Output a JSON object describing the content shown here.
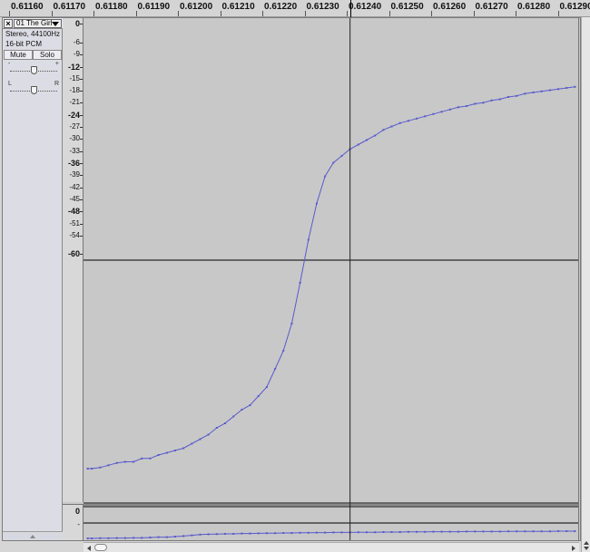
{
  "ruler": {
    "labels": [
      "0.61160",
      "0.61170",
      "0.61180",
      "0.61190",
      "0.61200",
      "0.61210",
      "0.61220",
      "0.61230",
      "0.61240",
      "0.61250",
      "0.61260",
      "0.61270",
      "0.61280",
      "0.61290"
    ]
  },
  "track": {
    "close_label": "×",
    "name": "01 The Girl",
    "info_line1": "Stereo, 44100Hz",
    "info_line2": "16-bit PCM",
    "mute_label": "Mute",
    "solo_label": "Solo",
    "gain_min_label": "-",
    "gain_max_label": "+",
    "pan_left_label": "L",
    "pan_right_label": "R",
    "gain_level": 0.5,
    "pan_level": 0.5
  },
  "scale_top": {
    "labels": [
      {
        "text": "0",
        "bold": true
      },
      {
        "text": "-6",
        "bold": false
      },
      {
        "text": "-9",
        "bold": false
      },
      {
        "text": "-12",
        "bold": true
      },
      {
        "text": "-15",
        "bold": false
      },
      {
        "text": "-18",
        "bold": false
      },
      {
        "text": "-21",
        "bold": false
      },
      {
        "text": "-24",
        "bold": true
      },
      {
        "text": "-27",
        "bold": false
      },
      {
        "text": "-30",
        "bold": false
      },
      {
        "text": "-33",
        "bold": false
      },
      {
        "text": "-36",
        "bold": true
      },
      {
        "text": "-39",
        "bold": false
      },
      {
        "text": "-42",
        "bold": false
      },
      {
        "text": "-45",
        "bold": false
      },
      {
        "text": "-48",
        "bold": true
      },
      {
        "text": "-51",
        "bold": false
      },
      {
        "text": "-54",
        "bold": false
      },
      {
        "text": "-60",
        "bold": true
      }
    ]
  },
  "scale_bottom": {
    "labels": [
      {
        "text": "0",
        "bold": true
      },
      {
        "text": "-",
        "bold": false
      }
    ]
  },
  "colors": {
    "waveform": "#5a5acc",
    "background": "#c8c8c8",
    "cursor": "#222222"
  },
  "chart_data": {
    "type": "line",
    "x": [
      0.61175,
      0.61176,
      0.61178,
      0.6118,
      0.61182,
      0.61184,
      0.61186,
      0.61188,
      0.6119,
      0.61192,
      0.61194,
      0.61196,
      0.61198,
      0.612,
      0.61202,
      0.61204,
      0.61206,
      0.61208,
      0.6121,
      0.61212,
      0.61214,
      0.61216,
      0.61218,
      0.6122,
      0.61222,
      0.61224,
      0.61226,
      0.61228,
      0.6123,
      0.61232,
      0.61234,
      0.61236,
      0.61238,
      0.6124,
      0.61242,
      0.61244,
      0.61246,
      0.61248,
      0.6125,
      0.61252,
      0.61254,
      0.61256,
      0.61258,
      0.6126,
      0.61262,
      0.61264,
      0.61266,
      0.61268,
      0.6127,
      0.61272,
      0.61274,
      0.61276,
      0.61278,
      0.6128,
      0.61282,
      0.61284,
      0.61286,
      0.61288,
      0.6129,
      0.61292
    ],
    "y": [
      -0.92,
      -0.92,
      -0.915,
      -0.905,
      -0.895,
      -0.89,
      -0.89,
      -0.875,
      -0.875,
      -0.86,
      -0.85,
      -0.84,
      -0.83,
      -0.81,
      -0.79,
      -0.77,
      -0.74,
      -0.72,
      -0.69,
      -0.66,
      -0.64,
      -0.6,
      -0.56,
      -0.48,
      -0.4,
      -0.28,
      -0.1,
      0.09,
      0.25,
      0.37,
      0.43,
      0.46,
      0.49,
      0.51,
      0.53,
      0.55,
      0.575,
      0.59,
      0.605,
      0.615,
      0.625,
      0.635,
      0.645,
      0.655,
      0.665,
      0.675,
      0.68,
      0.69,
      0.695,
      0.705,
      0.71,
      0.72,
      0.725,
      0.735,
      0.74,
      0.745,
      0.75,
      0.755,
      0.76,
      0.765
    ],
    "xlim": [
      0.61174,
      0.61293
    ],
    "ylim": [
      -1,
      1
    ],
    "cursor_x": 0.61238
  },
  "chart_data_bottom": {
    "type": "line",
    "y": [
      -0.85,
      -0.85,
      -0.84,
      -0.84,
      -0.83,
      -0.83,
      -0.82,
      -0.82,
      -0.8,
      -0.78,
      -0.78,
      -0.75,
      -0.72,
      -0.68,
      -0.64,
      -0.62,
      -0.61,
      -0.6,
      -0.6,
      -0.58,
      -0.58,
      -0.57,
      -0.56,
      -0.56,
      -0.55,
      -0.55,
      -0.54,
      -0.54,
      -0.53,
      -0.53,
      -0.52,
      -0.52,
      -0.52,
      -0.51,
      -0.51,
      -0.51,
      -0.5,
      -0.5,
      -0.5,
      -0.49,
      -0.49,
      -0.49,
      -0.48,
      -0.48,
      -0.48,
      -0.48,
      -0.47,
      -0.47,
      -0.47,
      -0.47,
      -0.47,
      -0.46,
      -0.46,
      -0.46,
      -0.46,
      -0.46,
      -0.46,
      -0.45,
      -0.45,
      -0.45
    ],
    "ylim": [
      -1,
      1
    ]
  }
}
